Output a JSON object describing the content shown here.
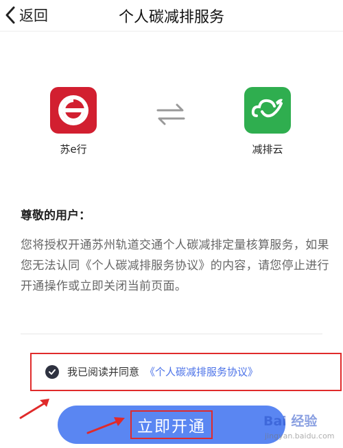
{
  "nav": {
    "back_label": "返回",
    "title": "个人碳减排服务"
  },
  "apps": {
    "left": {
      "name": "苏e行",
      "icon": "su-e-xing-logo-icon",
      "color": "#d21f30"
    },
    "right": {
      "name": "减排云",
      "icon": "jianpaiyun-logo-icon",
      "color": "#2fae4f"
    },
    "connector_icon": "swap-arrows-icon"
  },
  "content": {
    "greeting": "尊敬的用户：",
    "description": "您将授权开通苏州轨道交通个人碳减排定量核算服务，如果您无法认同《个人碳减排服务协议》的内容，请您停止进行开通操作或立即关闭当前页面。"
  },
  "agreement": {
    "checked": true,
    "text": "我已阅读并同意",
    "link": "《个人碳减排服务协议》"
  },
  "cta": {
    "label": "立即开通"
  },
  "watermark": {
    "main": "Bai 经验",
    "sub": "jingyan.baidu.com"
  },
  "colors": {
    "accent": "#5a86f2",
    "link": "#4b72e8",
    "annotation": "#e02a2a"
  }
}
